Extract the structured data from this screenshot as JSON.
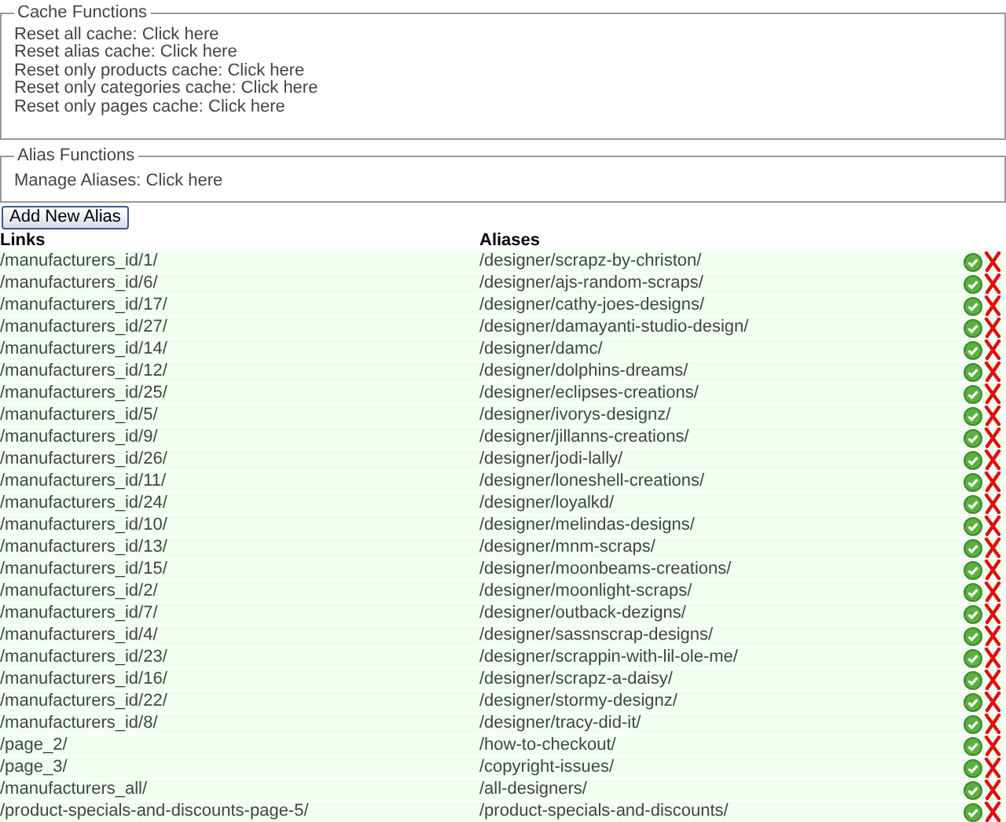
{
  "cache_functions": {
    "legend": "Cache Functions",
    "lines": [
      "Reset all cache: Click here",
      "Reset alias cache: Click here",
      "Reset only products cache: Click here",
      "Reset only categories cache: Click here",
      "Reset only pages cache: Click here"
    ]
  },
  "alias_functions": {
    "legend": "Alias Functions",
    "lines": [
      "Manage Aliases: Click here"
    ]
  },
  "add_button": "Add New Alias",
  "table": {
    "columns": [
      "Links",
      "Aliases"
    ],
    "rows": [
      {
        "link": "/manufacturers_id/1/",
        "alias": "/designer/scrapz-by-christon/"
      },
      {
        "link": "/manufacturers_id/6/",
        "alias": "/designer/ajs-random-scraps/"
      },
      {
        "link": "/manufacturers_id/17/",
        "alias": "/designer/cathy-joes-designs/"
      },
      {
        "link": "/manufacturers_id/27/",
        "alias": "/designer/damayanti-studio-design/"
      },
      {
        "link": "/manufacturers_id/14/",
        "alias": "/designer/damc/"
      },
      {
        "link": "/manufacturers_id/12/",
        "alias": "/designer/dolphins-dreams/"
      },
      {
        "link": "/manufacturers_id/25/",
        "alias": "/designer/eclipses-creations/"
      },
      {
        "link": "/manufacturers_id/5/",
        "alias": "/designer/ivorys-designz/"
      },
      {
        "link": "/manufacturers_id/9/",
        "alias": "/designer/jillanns-creations/"
      },
      {
        "link": "/manufacturers_id/26/",
        "alias": "/designer/jodi-lally/"
      },
      {
        "link": "/manufacturers_id/11/",
        "alias": "/designer/loneshell-creations/"
      },
      {
        "link": "/manufacturers_id/24/",
        "alias": "/designer/loyalkd/"
      },
      {
        "link": "/manufacturers_id/10/",
        "alias": "/designer/melindas-designs/"
      },
      {
        "link": "/manufacturers_id/13/",
        "alias": "/designer/mnm-scraps/"
      },
      {
        "link": "/manufacturers_id/15/",
        "alias": "/designer/moonbeams-creations/"
      },
      {
        "link": "/manufacturers_id/2/",
        "alias": "/designer/moonlight-scraps/"
      },
      {
        "link": "/manufacturers_id/7/",
        "alias": "/designer/outback-dezigns/"
      },
      {
        "link": "/manufacturers_id/4/",
        "alias": "/designer/sassnscrap-designs/"
      },
      {
        "link": "/manufacturers_id/23/",
        "alias": "/designer/scrappin-with-lil-ole-me/"
      },
      {
        "link": "/manufacturers_id/16/",
        "alias": "/designer/scrapz-a-daisy/"
      },
      {
        "link": "/manufacturers_id/22/",
        "alias": "/designer/stormy-designz/"
      },
      {
        "link": "/manufacturers_id/8/",
        "alias": "/designer/tracy-did-it/"
      },
      {
        "link": "/page_2/",
        "alias": "/how-to-checkout/"
      },
      {
        "link": "/page_3/",
        "alias": "/copyright-issues/"
      },
      {
        "link": "/manufacturers_all/",
        "alias": "/all-designers/"
      },
      {
        "link": "/product-specials-and-discounts-page-5/",
        "alias": "/product-specials-and-discounts/"
      }
    ]
  }
}
